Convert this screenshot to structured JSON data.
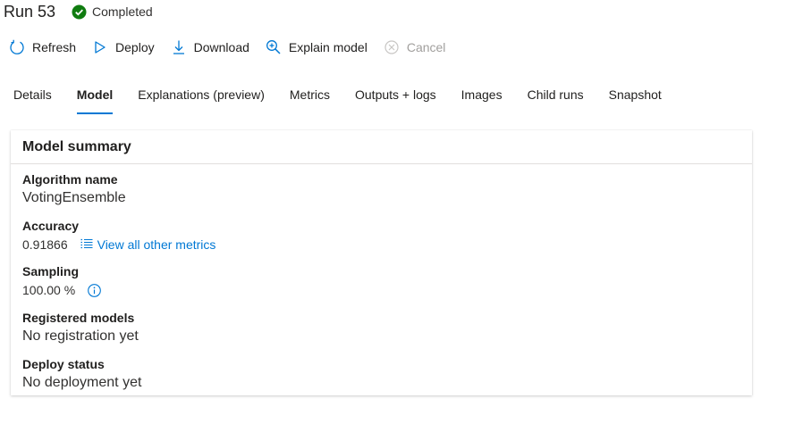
{
  "header": {
    "title": "Run 53",
    "status": "Completed",
    "status_color": "#107c10"
  },
  "toolbar": {
    "refresh": "Refresh",
    "deploy": "Deploy",
    "download": "Download",
    "explain": "Explain model",
    "cancel": "Cancel"
  },
  "tabs": [
    {
      "label": "Details"
    },
    {
      "label": "Model",
      "active": true
    },
    {
      "label": "Explanations (preview)"
    },
    {
      "label": "Metrics"
    },
    {
      "label": "Outputs + logs"
    },
    {
      "label": "Images"
    },
    {
      "label": "Child runs"
    },
    {
      "label": "Snapshot"
    }
  ],
  "summary": {
    "title": "Model summary",
    "algorithm_label": "Algorithm name",
    "algorithm_value": "VotingEnsemble",
    "accuracy_label": "Accuracy",
    "accuracy_value": "0.91866",
    "metrics_link": "View all other metrics",
    "sampling_label": "Sampling",
    "sampling_value": "100.00 %",
    "registered_label": "Registered models",
    "registered_value": "No registration yet",
    "deploy_label": "Deploy status",
    "deploy_value": "No deployment yet"
  },
  "colors": {
    "accent": "#0078d4",
    "success": "#107c10",
    "disabled": "#a19f9d"
  }
}
